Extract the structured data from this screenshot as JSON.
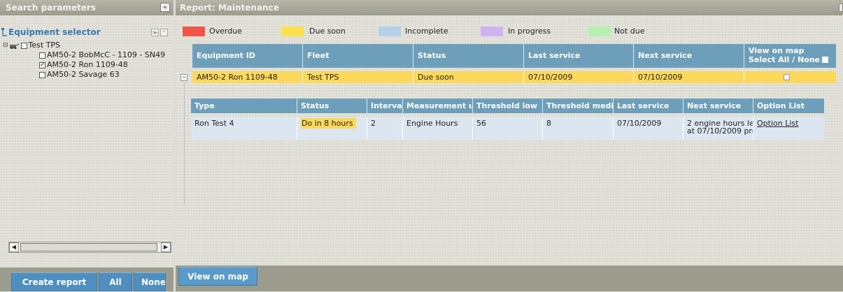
{
  "left_panel": {
    "title": "Search parameters",
    "collapse_glyph": "«",
    "equipment_selector": {
      "title": "Equipment selector",
      "icon": "equipment-selector-icon",
      "btn_a": "≫",
      "btn_b": "⌃"
    },
    "tree": {
      "root": {
        "label": "Test TPS",
        "checked": false
      },
      "children": [
        {
          "label": "AM50-2 BobMcC - 1109 - SN49",
          "checked": false,
          "mark": ""
        },
        {
          "label": "AM50-2 Ron 1109-48",
          "checked": true,
          "mark": "✓"
        },
        {
          "label": "AM50-2 Savage 63",
          "checked": false,
          "mark": ""
        }
      ]
    },
    "buttons": {
      "create_report": "Create report",
      "all": "All",
      "none": "None"
    }
  },
  "report": {
    "title": "Report: Maintenance",
    "legend": [
      {
        "label": "Overdue",
        "color": "#f2544a"
      },
      {
        "label": "Due soon",
        "color": "#ffe14d"
      },
      {
        "label": "Incomplete",
        "color": "#b7d0ea"
      },
      {
        "label": "In progress",
        "color": "#cfb3f0"
      },
      {
        "label": "Not due",
        "color": "#b7f0b0"
      }
    ],
    "columns": {
      "equipment_id": "Equipment ID",
      "fleet": "Fleet",
      "status": "Status",
      "last_service": "Last service",
      "next_service": "Next service",
      "view_on_map": "View on map",
      "select_all_none": "Select All / None"
    },
    "row": {
      "equipment_id": "AM50-2 Ron 1109-48",
      "fleet": "Test TPS",
      "status": "Due soon",
      "last_service": "07/10/2009",
      "next_service": "07/10/2009",
      "expand_glyph": "⊟"
    },
    "detail_columns": {
      "type": "Type",
      "status": "Status",
      "interval": "Interval",
      "measurement_unit": "Measurement u",
      "threshold_low": "Threshold low",
      "threshold_medium": "Threshold medi",
      "last_service": "Last service",
      "next_service": "Next service",
      "option_list": "Option List"
    },
    "detail_row": {
      "type": "Ron Test 4",
      "status": "Do in 8 hours",
      "interval": "2",
      "measurement_unit": "Engine Hours",
      "threshold_low": "56",
      "threshold_medium": "8",
      "last_service": "07/10/2009",
      "next_service_line1": "2 engine hours le",
      "next_service_line2": "at 07/10/2009 pro",
      "option_list": "Option List"
    },
    "view_on_map_button": "View on map"
  }
}
